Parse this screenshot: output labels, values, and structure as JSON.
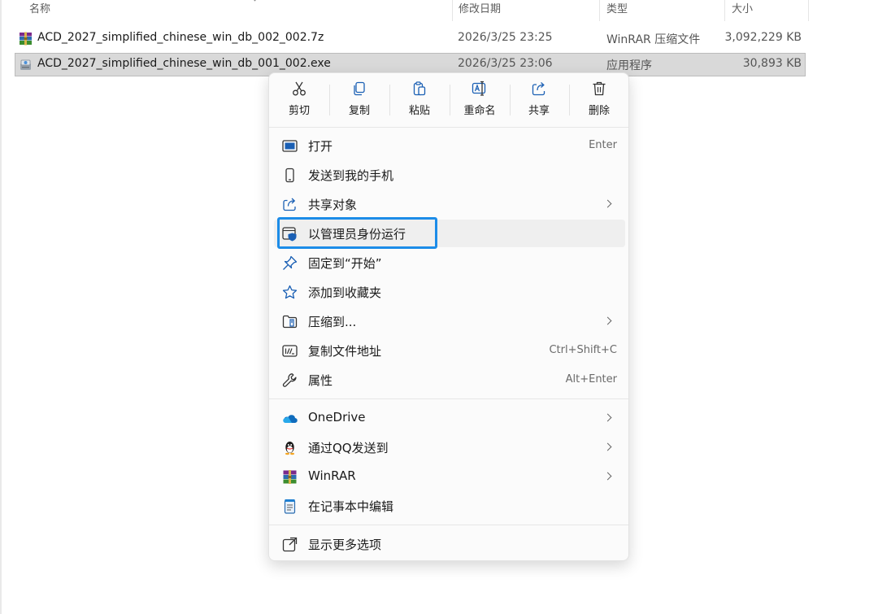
{
  "columns": {
    "name": "名称",
    "date": "修改日期",
    "type": "类型",
    "size": "大小"
  },
  "files": [
    {
      "name": "ACD_2027_simplified_chinese_win_db_002_002.7z",
      "date": "2026/3/25 23:25",
      "type": "WinRAR 压缩文件",
      "size": "3,092,229 KB",
      "icon": "winrar-archive-icon",
      "selected": false
    },
    {
      "name": "ACD_2027_simplified_chinese_win_db_001_002.exe",
      "date": "2026/3/25 23:06",
      "type": "应用程序",
      "size": "30,893 KB",
      "icon": "installer-exe-icon",
      "selected": true
    }
  ],
  "context_menu": {
    "quick_actions": [
      {
        "label": "剪切",
        "icon": "cut-icon"
      },
      {
        "label": "复制",
        "icon": "copy-icon"
      },
      {
        "label": "粘贴",
        "icon": "paste-icon"
      },
      {
        "label": "重命名",
        "icon": "rename-icon"
      },
      {
        "label": "共享",
        "icon": "share-icon"
      },
      {
        "label": "删除",
        "icon": "delete-icon"
      }
    ],
    "items": [
      {
        "label": "打开",
        "shortcut": "Enter",
        "icon": "open-icon"
      },
      {
        "label": "发送到我的手机",
        "icon": "phone-icon"
      },
      {
        "label": "共享对象",
        "icon": "share-with-icon",
        "submenu": true
      },
      {
        "label": "以管理员身份运行",
        "icon": "admin-shield-icon",
        "highlighted": true
      },
      {
        "label": "固定到“开始”",
        "icon": "pin-icon"
      },
      {
        "label": "添加到收藏夹",
        "icon": "star-icon"
      },
      {
        "label": "压缩到...",
        "icon": "compress-icon",
        "submenu": true
      },
      {
        "label": "复制文件地址",
        "shortcut": "Ctrl+Shift+C",
        "icon": "copy-path-icon"
      },
      {
        "label": "属性",
        "shortcut": "Alt+Enter",
        "icon": "wrench-icon"
      }
    ],
    "app_items": [
      {
        "label": "OneDrive",
        "icon": "onedrive-icon",
        "submenu": true
      },
      {
        "label": "通过QQ发送到",
        "icon": "qq-icon",
        "submenu": true
      },
      {
        "label": "WinRAR",
        "icon": "winrar-icon",
        "submenu": true
      },
      {
        "label": "在记事本中编辑",
        "icon": "notepad-icon"
      }
    ],
    "more_options": {
      "label": "显示更多选项",
      "icon": "more-options-icon"
    }
  },
  "colors": {
    "highlight_border": "#1c8ce8",
    "selection": "#d9d9d9"
  }
}
